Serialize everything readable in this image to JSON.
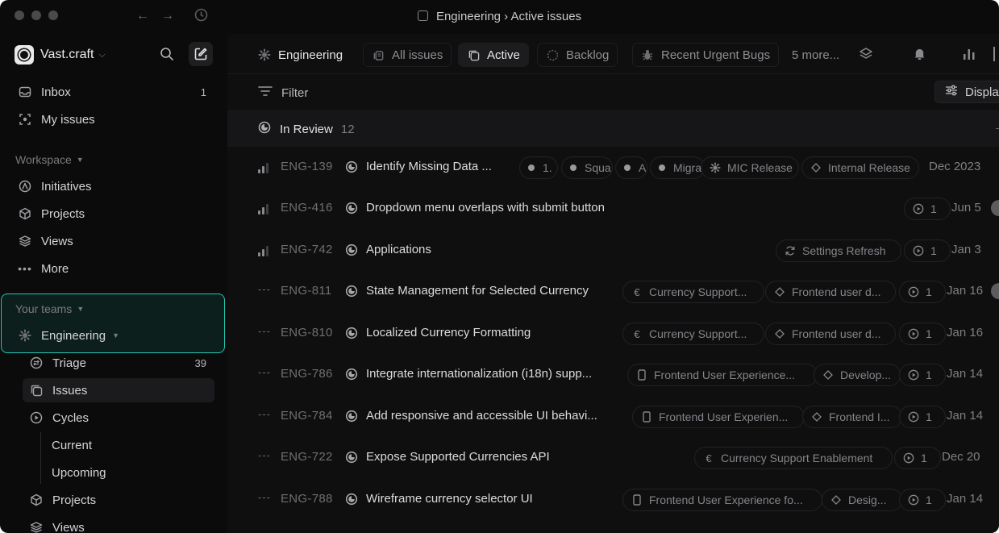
{
  "window": {
    "title": "Engineering › Active issues"
  },
  "workspace": {
    "name": "Vast.craft"
  },
  "sidebar": {
    "inbox": {
      "label": "Inbox",
      "count": "1"
    },
    "my_issues": {
      "label": "My issues"
    },
    "workspace_label": "Workspace",
    "workspace_items": [
      "Initiatives",
      "Projects",
      "Views",
      "More"
    ],
    "your_teams_label": "Your teams",
    "team": {
      "label": "Engineering"
    },
    "team_items": {
      "triage": {
        "label": "Triage",
        "count": "39"
      },
      "issues": {
        "label": "Issues"
      },
      "cycles": {
        "label": "Cycles"
      },
      "current": {
        "label": "Current"
      },
      "upcoming": {
        "label": "Upcoming"
      },
      "projects": {
        "label": "Projects"
      },
      "views": {
        "label": "Views"
      }
    }
  },
  "tabs": {
    "team": "Engineering",
    "all_issues": "All issues",
    "active": "Active",
    "backlog": "Backlog",
    "recent_bugs": "Recent Urgent Bugs",
    "more": "5 more..."
  },
  "filterbar": {
    "filter": "Filter",
    "display": "Display"
  },
  "group": {
    "label": "In Review",
    "count": "12"
  },
  "issues": [
    {
      "priority": "medium",
      "id": "ENG-139",
      "title": "Identify Missing Data ...",
      "chips": [
        "1.",
        "Squa",
        "A",
        "Migra"
      ],
      "cycle_chip": "MIC Release",
      "project_chip": "Internal Release",
      "date": "Dec 2023"
    },
    {
      "priority": "medium",
      "id": "ENG-416",
      "title": "Dropdown menu overlaps with submit button",
      "cycle": "1",
      "date": "Jun 5"
    },
    {
      "priority": "medium",
      "id": "ENG-742",
      "title": "Applications",
      "project_chip": "Settings Refresh",
      "cycle": "1",
      "date": "Jan 3"
    },
    {
      "priority": "none",
      "id": "ENG-811",
      "title": "State Management for Selected Currency",
      "project_chip": "Currency Support...",
      "milestone_chip": "Frontend user d...",
      "cycle": "1",
      "date": "Jan 16"
    },
    {
      "priority": "none",
      "id": "ENG-810",
      "title": "Localized Currency Formatting",
      "project_chip": "Currency Support...",
      "milestone_chip": "Frontend user d...",
      "cycle": "1",
      "date": "Jan 16"
    },
    {
      "priority": "none",
      "id": "ENG-786",
      "title": "Integrate internationalization (i18n) supp...",
      "project_chip": "Frontend User Experience...",
      "milestone_chip": "Develop...",
      "cycle": "1",
      "date": "Jan 14"
    },
    {
      "priority": "none",
      "id": "ENG-784",
      "title": "Add responsive and accessible UI behavi...",
      "project_chip": "Frontend User Experien...",
      "milestone_chip": "Frontend I...",
      "cycle": "1",
      "date": "Jan 14"
    },
    {
      "priority": "none",
      "id": "ENG-722",
      "title": "Expose Supported Currencies API",
      "project_chip": "Currency Support Enablement",
      "cycle": "1",
      "date": "Dec 20"
    },
    {
      "priority": "none",
      "id": "ENG-788",
      "title": "Wireframe currency selector UI",
      "project_chip": "Frontend User Experience fo...",
      "milestone_chip": "Desig...",
      "cycle": "1",
      "date": "Jan 14"
    }
  ]
}
